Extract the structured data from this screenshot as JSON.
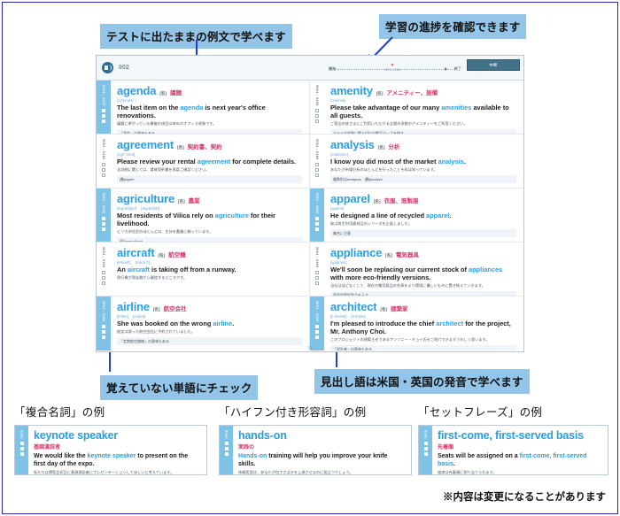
{
  "callouts": {
    "top_left": "テストに出たままの例文で学べます",
    "top_right": "学習の進捗を確認できます",
    "bottom_left": "覚えていない単語にチェック",
    "bottom_right": "見出し語は米国・英国の発音で学べます"
  },
  "footnote": "※内容は変更になることがあります",
  "app": {
    "header": {
      "audio_icon": "speaker-icon",
      "track_number": "002",
      "progress_start_label": "開始",
      "progress_end_label": "終了",
      "progress_current_marker": "▼",
      "progress_current_label": "0071 - 0080",
      "action_button_label": "中断"
    },
    "page_number": "15",
    "entries_left": [
      {
        "range": "0061 - 0070",
        "marker_on": true,
        "headword": "agenda",
        "pos": "[名]",
        "meaning": "議題",
        "phonetics": [
          "[ədʒéndə]"
        ],
        "sentence_pre": "The last item on the ",
        "sentence_key": "agenda",
        "sentence_post": " is next year's office renovations.",
        "jp_sentence": "議題に挙がっている最後の項目は来年のオフィス改装です。",
        "note": "「予定」の意味もある"
      },
      {
        "range": "0061 - 0160",
        "marker_on": false,
        "headword": "agreement",
        "pos": "[名]",
        "meaning": "契約書、契約",
        "phonetics": [
          "[əgríːmənt]"
        ],
        "sentence_pre": "Please review your rental ",
        "sentence_key": "agreement",
        "sentence_post": " for complete details.",
        "jp_sentence": "全詳細に関しては、賃貸契約書を再度ご確認ください。",
        "note": "[動]agree"
      },
      {
        "range": "0061 - 0160",
        "marker_on": true,
        "headword": "agriculture",
        "pos": "[名]",
        "meaning": "農業",
        "phonetics": [
          "[ǽgrɪkʌ̀ltʃər]",
          "[ǽgrɪkʌ̀ltʃə]"
        ],
        "sentence_pre": "Most residents of Vilica rely on ",
        "sentence_key": "agriculture",
        "sentence_post": " for their livelihood.",
        "jp_sentence": "ビリカの住民のほとんどは、生計を農業に頼っています。",
        "note": "[形]agricultural"
      },
      {
        "range": "0061 - 0160",
        "marker_on": false,
        "headword": "aircraft",
        "pos": "[名]",
        "meaning": "航空機",
        "phonetics": [
          "[érkræ̀ft]",
          "[éəkrɑ̀ːft]"
        ],
        "sentence_pre": "An ",
        "sentence_key": "aircraft",
        "sentence_post": " is taking off from a runway.",
        "jp_sentence": "飛行機が滑走路から離陸するところです。",
        "note": ""
      },
      {
        "range": "0061 - 0160",
        "marker_on": true,
        "headword": "airline",
        "pos": "[名]",
        "meaning": "航空会社",
        "phonetics": [
          "[érlàɪn]",
          "[éəlàɪn]"
        ],
        "sentence_pre": "She was booked on the wrong ",
        "sentence_key": "airline",
        "sentence_post": ".",
        "jp_sentence": "彼女は誤った航空会社に予約されていました。",
        "note": "「定期航空路線」の意味もある"
      }
    ],
    "entries_right": [
      {
        "range": "0061 - 0160",
        "marker_on": false,
        "headword": "amenity",
        "pos": "[名]",
        "meaning": "アメニティー、設備",
        "phonetics": [
          "[əménəti]"
        ],
        "sentence_pre": "Please take advantage of our many ",
        "sentence_key": "amenities",
        "sentence_post": " available to all guests.",
        "jp_sentence": "ご宿泊の皆さまにご利用いただける全館の多数のアメニティーをご利用ください。",
        "note": "ホテルの部屋に備え付けの備品グッズを指す"
      },
      {
        "range": "0061 - 0160",
        "marker_on": false,
        "headword": "analysis",
        "pos": "[名]",
        "meaning": "分析",
        "phonetics": [
          "[ənǽləsɪs]"
        ],
        "sentence_pre": "I know you did most of the market ",
        "sentence_key": "analysis",
        "sentence_post": ".",
        "jp_sentence": "あなたが市場分析のほとんどを行ったことを私は知っています。",
        "note": "複数形はanalyses　[動]analyze"
      },
      {
        "range": "0061 - 0160",
        "marker_on": true,
        "headword": "apparel",
        "pos": "[名]",
        "meaning": "衣服、既製服",
        "phonetics": [
          "[əpǽrəl]"
        ],
        "sentence_pre": "He designed a line of recycled ",
        "sentence_key": "apparel",
        "sentence_post": ".",
        "jp_sentence": "彼は再生利用素材品のシリーズを企画しました。",
        "note": "集合に注意"
      },
      {
        "range": "0061 - 0160",
        "marker_on": false,
        "headword": "appliance",
        "pos": "[名]",
        "meaning": "電気器具",
        "phonetics": [
          "[əpláɪəns]"
        ],
        "sentence_pre": "We'll soon be replacing our current stock of ",
        "sentence_key": "appliances",
        "sentence_post": " with more eco-friendly versions.",
        "jp_sentence": "当社はほどなくして、現在の電気製品の在庫をより環境に優しいものに置き換えていきます。",
        "note": "家庭用電気製品を示す"
      },
      {
        "range": "0061 - 0160",
        "marker_on": true,
        "headword": "architect",
        "pos": "[名]",
        "meaning": "建築家",
        "phonetics": [
          "[ɑ́ːrkətèkt]",
          "[ɑ́ːkɪtèkt]"
        ],
        "sentence_pre": "I'm pleased to introduce the chief ",
        "sentence_key": "architect",
        "sentence_post": " for the project, Mr. Anthony Choi.",
        "jp_sentence": "このプロジェクトの建築主任であるアンソニー・チョイ氏をご紹介できますうれしく思います。",
        "note": "「設計者」の意味もある"
      }
    ]
  },
  "examples": [
    {
      "title": "「複合名詞」の例",
      "range": "0162",
      "headword": "keynote speaker",
      "jp_meaning": "基調演説者",
      "sentence_pre": "We would like the ",
      "sentence_key": "keynote speaker",
      "sentence_post": " to present on the first day of the expo.",
      "jp_sentence": "私たちは博覧会初日に基調演説者にプレゼンテーションしてほしいと考えています。"
    },
    {
      "title": "「ハイフン付き形容詞」の例",
      "range": "0164",
      "headword": "hands-on",
      "jp_meaning": "実践の",
      "sentence_pre": "",
      "sentence_key": "Hands-on",
      "sentence_post": " training will help you improve your knife skills.",
      "jp_sentence": "体験実習は、あなたが包丁さばきを上達させるのに役立つでしょう。"
    },
    {
      "title": "「セットフレーズ」の例",
      "range": "0166",
      "headword": "first-come, first-served basis",
      "jp_meaning": "先着順",
      "sentence_pre": "Seats will be assigned on a ",
      "sentence_key": "first-come, first-served basis",
      "sentence_post": ".",
      "jp_sentence": "座席は先着順に割り当てられます。"
    }
  ],
  "colors": {
    "callout_bg": "#93c5e8",
    "headword": "#2b9ee3",
    "meaning": "#d6356b",
    "marker_on": "#7ec2e8",
    "button": "#41728a",
    "annotation": "#1c3fd4"
  }
}
